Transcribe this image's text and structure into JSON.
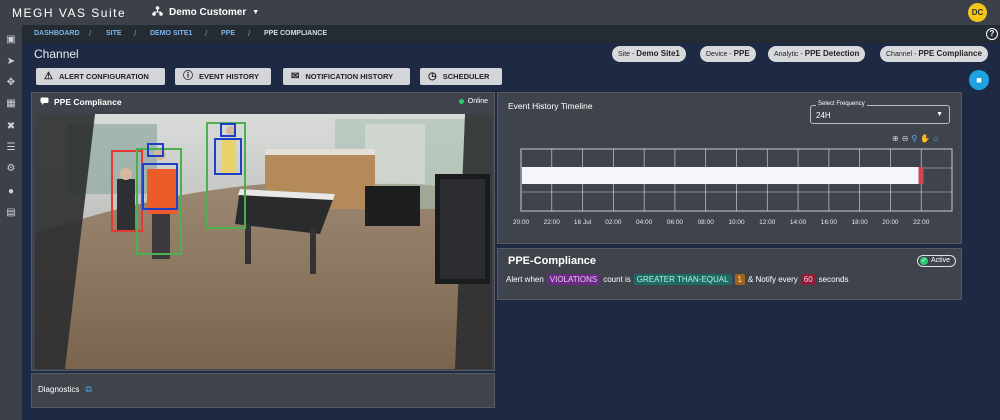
{
  "app": {
    "title": "MEGH VAS Suite",
    "customer": "Demo Customer",
    "user_initials": "DC"
  },
  "breadcrumb": [
    "DASHBOARD",
    "SITE",
    "DEMO SITE1",
    "PPE",
    "PPE COMPLIANCE"
  ],
  "page": {
    "title": "Channel"
  },
  "context_pills": [
    {
      "key": "Site -",
      "value": "Demo Site1"
    },
    {
      "key": "Device -",
      "value": "PPE"
    },
    {
      "key": "Analytic -",
      "value": "PPE Detection"
    },
    {
      "key": "Channel -",
      "value": "PPE Compliance"
    }
  ],
  "toolbar": {
    "alert_config": "ALERT CONFIGURATION",
    "event_history": "EVENT HISTORY",
    "notification_history": "NOTIFICATION HISTORY",
    "scheduler": "SCHEDULER"
  },
  "camera_panel": {
    "title": "PPE Compliance",
    "status": "Online"
  },
  "diagnostics": {
    "label": "Diagnostics"
  },
  "timeline": {
    "title": "Event History Timeline",
    "frequency_label": "Select Frequency",
    "frequency_value": "24H",
    "tick_labels": [
      "20:00",
      "22:00",
      "16 Jul",
      "02:00",
      "04:00",
      "06:00",
      "08:00",
      "10:00",
      "12:00",
      "14:00",
      "16:00",
      "18:00",
      "20:00",
      "22:00"
    ],
    "bar_fill_fraction": 0.934
  },
  "rule": {
    "title": "PPE-Compliance",
    "status": "Active",
    "text_1": "Alert when",
    "metric": "VIOLATIONS",
    "text_2": "count is",
    "operator": "GREATER THAN-EQUAL",
    "threshold": "1",
    "text_3": "& Notify every",
    "interval": "60",
    "text_4": "seconds"
  },
  "colors": {
    "accent": "#1fa2e0",
    "online": "#2ecc71",
    "avatar": "#f5c518"
  }
}
